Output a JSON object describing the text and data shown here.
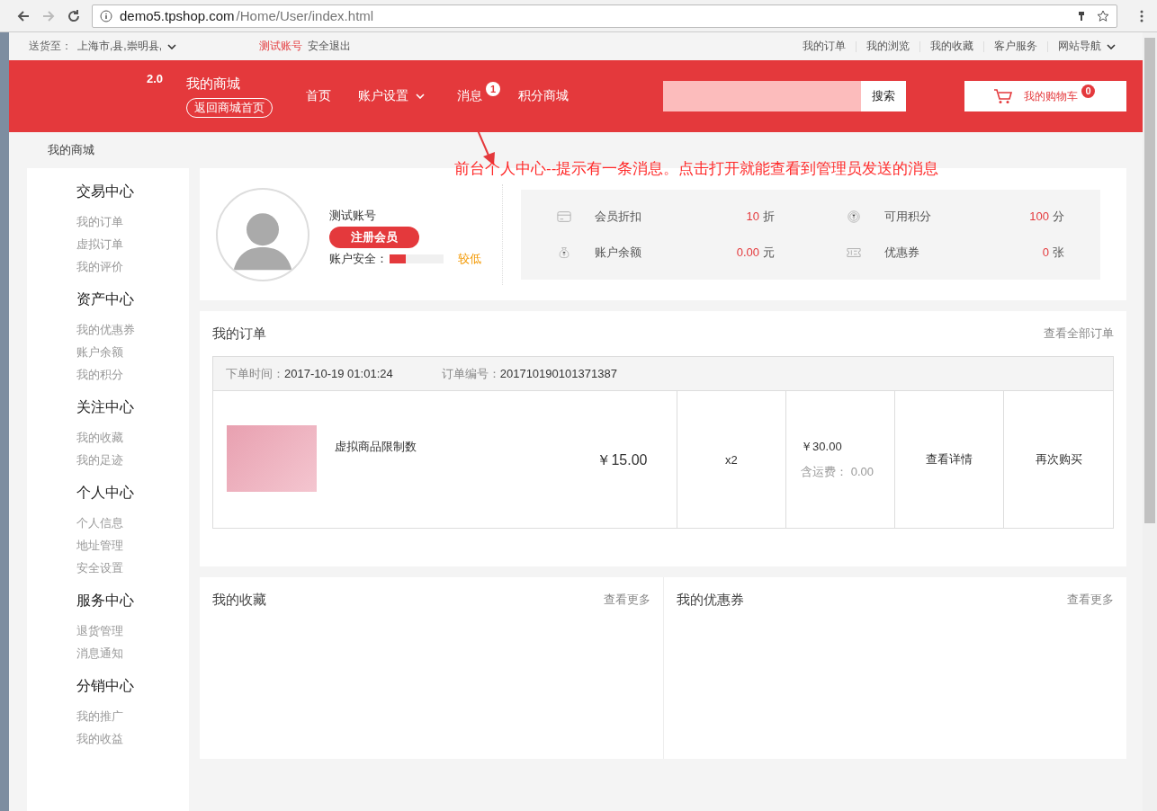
{
  "browser": {
    "url_host": "demo5.tpshop.com",
    "url_path": "/Home/User/index.html"
  },
  "topbar": {
    "deliver_label": "送货至：",
    "location": "上海市,县,崇明县,",
    "username": "测试账号",
    "logout": "安全退出",
    "links": [
      "我的订单",
      "我的浏览",
      "我的收藏",
      "客户服务",
      "网站导航"
    ]
  },
  "header": {
    "version": "2.0",
    "title": "我的商城",
    "back_home": "返回商城首页",
    "nav": [
      {
        "label": "首页",
        "kind": "plain"
      },
      {
        "label": "账户设置",
        "kind": "dropdown"
      },
      {
        "label": "消息",
        "kind": "badge",
        "badge": "1"
      },
      {
        "label": "积分商城",
        "kind": "plain"
      }
    ],
    "search_button": "搜索",
    "cart": {
      "label": "我的购物车",
      "count": "0"
    }
  },
  "annotation": {
    "text": "前台个人中心--提示有一条消息。点击打开就能查看到管理员发送的消息"
  },
  "breadcrumb": "我的商城",
  "sidebar": [
    {
      "title": "交易中心",
      "items": [
        "我的订单",
        "虚拟订单",
        "我的评价"
      ]
    },
    {
      "title": "资产中心",
      "items": [
        "我的优惠券",
        "账户余额",
        "我的积分"
      ]
    },
    {
      "title": "关注中心",
      "items": [
        "我的收藏",
        "我的足迹"
      ]
    },
    {
      "title": "个人中心",
      "items": [
        "个人信息",
        "地址管理",
        "安全设置"
      ]
    },
    {
      "title": "服务中心",
      "items": [
        "退货管理",
        "消息通知"
      ]
    },
    {
      "title": "分销中心",
      "items": [
        "我的推广",
        "我的收益"
      ]
    }
  ],
  "profile": {
    "name": "测试账号",
    "member_button": "注册会员",
    "security_label": "账户安全：",
    "security": {
      "level": 0.3
    },
    "security_text": "较低",
    "stats": [
      {
        "kind": "card",
        "label": "会员折扣",
        "value": "10",
        "unit": "折"
      },
      {
        "kind": "coin",
        "label": "可用积分",
        "value": "100",
        "unit": "分"
      },
      {
        "kind": "bag",
        "label": "账户余额",
        "value": "0.00",
        "unit": "元"
      },
      {
        "kind": "ticket",
        "label": "优惠券",
        "value": "0",
        "unit": "张"
      }
    ]
  },
  "orders": {
    "title": "我的订单",
    "view_all": "查看全部订单",
    "placed_label": "下单时间：",
    "placed_time": "2017-10-19 01:01:24",
    "number_label": "订单编号：",
    "number": "201710190101371387",
    "items": [
      {
        "name": "虚拟商品限制数",
        "price": "￥15.00",
        "qty": "x2",
        "total": "￥30.00",
        "shipping_label": "含运费：",
        "shipping": "0.00",
        "detail_button": "查看详情",
        "rebuy_button": "再次购买"
      }
    ]
  },
  "panels": [
    {
      "title": "我的收藏",
      "more": "查看更多"
    },
    {
      "title": "我的优惠券",
      "more": "查看更多"
    }
  ]
}
